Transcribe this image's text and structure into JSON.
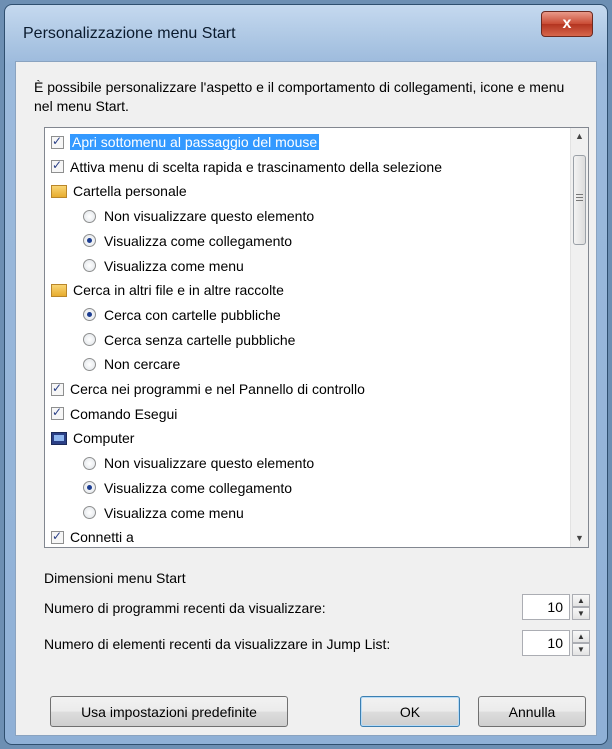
{
  "window": {
    "title": "Personalizzazione menu Start",
    "close_label": "x"
  },
  "intro": "È possibile personalizzare l'aspetto e il comportamento di collegamenti, icone e menu nel menu Start.",
  "list": {
    "items": [
      {
        "type": "checkbox",
        "checked": true,
        "selected": true,
        "label": "Apri sottomenu al passaggio del mouse"
      },
      {
        "type": "checkbox",
        "checked": true,
        "label": "Attiva menu di scelta rapida e trascinamento della selezione"
      },
      {
        "type": "header",
        "icon": "personal-folder-icon",
        "label": "Cartella personale"
      },
      {
        "type": "radio",
        "checked": false,
        "label": "Non visualizzare questo elemento"
      },
      {
        "type": "radio",
        "checked": true,
        "label": "Visualizza come collegamento"
      },
      {
        "type": "radio",
        "checked": false,
        "label": "Visualizza come menu"
      },
      {
        "type": "header",
        "icon": "search-folder-icon",
        "label": "Cerca in altri file e in altre raccolte"
      },
      {
        "type": "radio",
        "checked": true,
        "label": "Cerca con cartelle pubbliche"
      },
      {
        "type": "radio",
        "checked": false,
        "label": "Cerca senza cartelle pubbliche"
      },
      {
        "type": "radio",
        "checked": false,
        "label": "Non cercare"
      },
      {
        "type": "checkbox",
        "checked": true,
        "label": "Cerca nei programmi e nel Pannello di controllo"
      },
      {
        "type": "checkbox",
        "checked": true,
        "label": "Comando Esegui"
      },
      {
        "type": "header",
        "icon": "computer-icon",
        "label": "Computer"
      },
      {
        "type": "radio",
        "checked": false,
        "label": "Non visualizzare questo elemento"
      },
      {
        "type": "radio",
        "checked": true,
        "label": "Visualizza come collegamento"
      },
      {
        "type": "radio",
        "checked": false,
        "label": "Visualizza come menu"
      },
      {
        "type": "checkbox",
        "checked": true,
        "label": "Connetti a"
      }
    ]
  },
  "size_group": {
    "title": "Dimensioni menu Start",
    "recent_programs_label": "Numero di programmi recenti da visualizzare:",
    "recent_programs_value": "10",
    "jump_list_label": "Numero di elementi recenti da visualizzare in Jump List:",
    "jump_list_value": "10"
  },
  "buttons": {
    "defaults": "Usa impostazioni predefinite",
    "ok": "OK",
    "cancel": "Annulla"
  },
  "icons": {
    "close": "close-icon",
    "scroll_up": "scroll-up-icon",
    "scroll_down": "scroll-down-icon",
    "spin_up": "spin-up-icon",
    "spin_down": "spin-down-icon"
  }
}
